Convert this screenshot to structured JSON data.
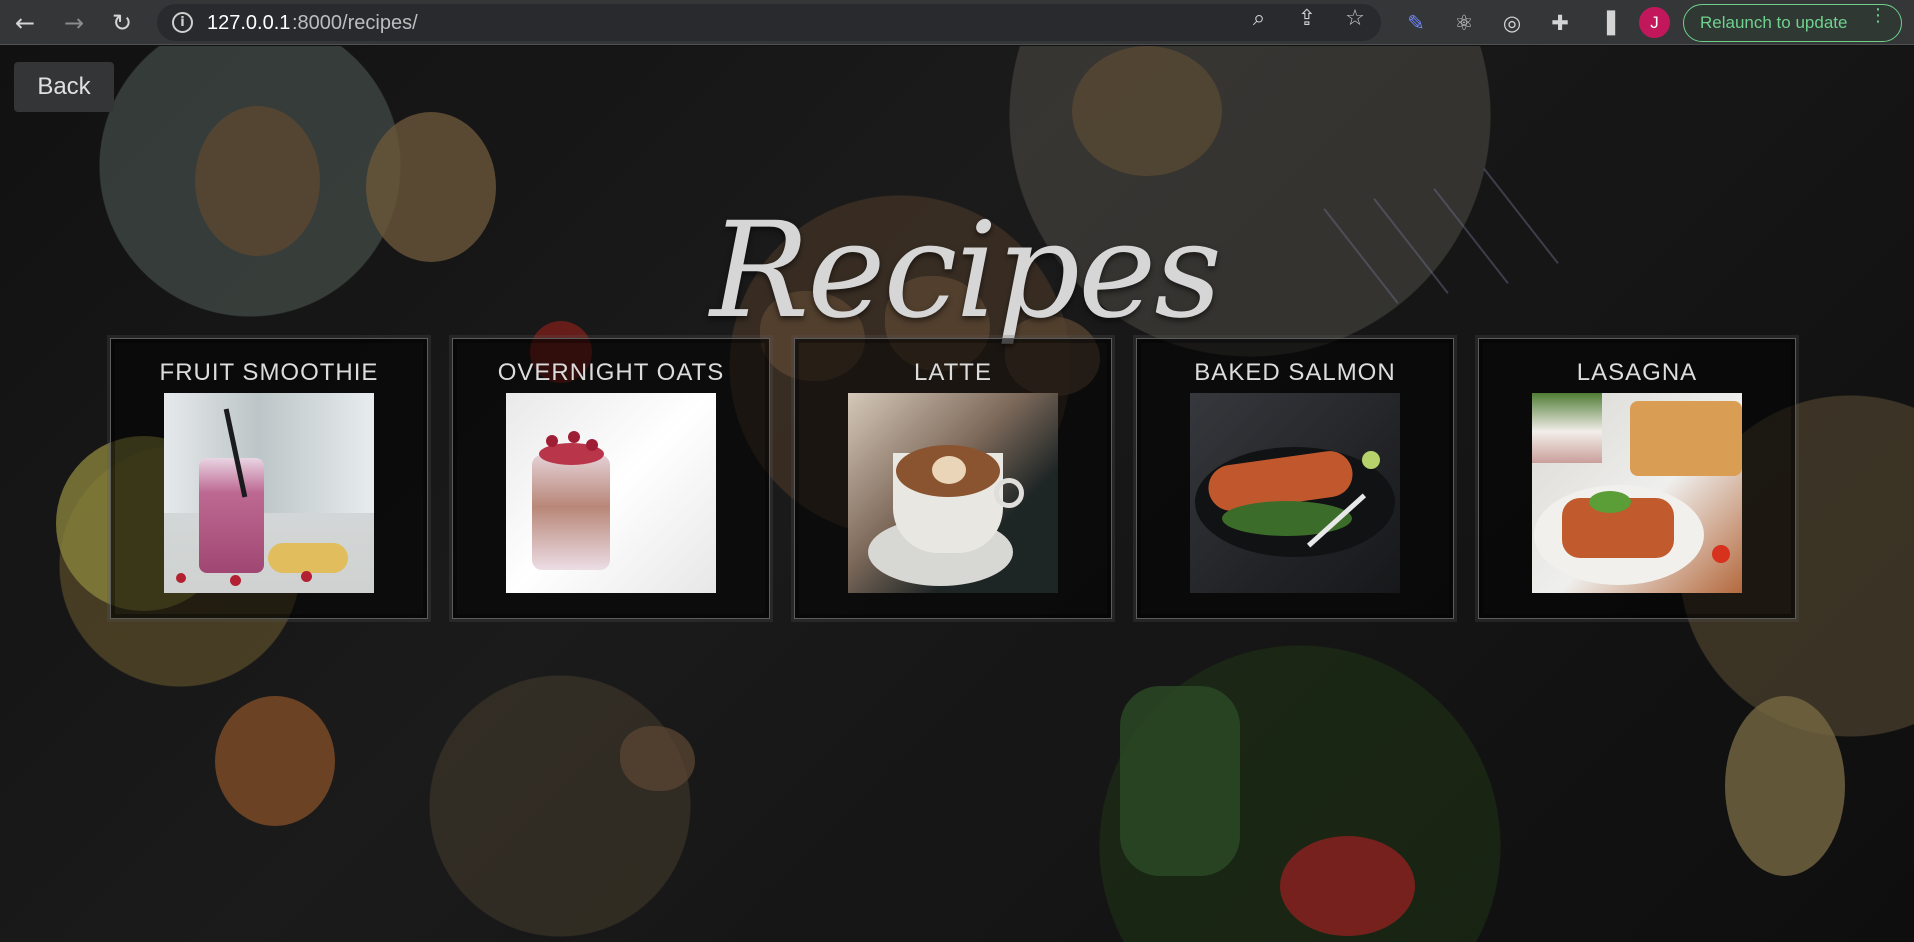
{
  "browser": {
    "url_host": "127.0.0.1",
    "url_path": ":8000/recipes/",
    "profile_initial": "J",
    "relaunch_label": "Relaunch to update"
  },
  "page": {
    "back_label": "Back",
    "title": "Recipes",
    "recipes": [
      {
        "name": "FRUIT SMOOTHIE"
      },
      {
        "name": "OVERNIGHT OATS"
      },
      {
        "name": "LATTE"
      },
      {
        "name": "BAKED SALMON"
      },
      {
        "name": "LASAGNA"
      }
    ]
  },
  "colors": {
    "accent": "#6ed08b",
    "profile": "#c2185b",
    "text": "#dcdcdc"
  }
}
